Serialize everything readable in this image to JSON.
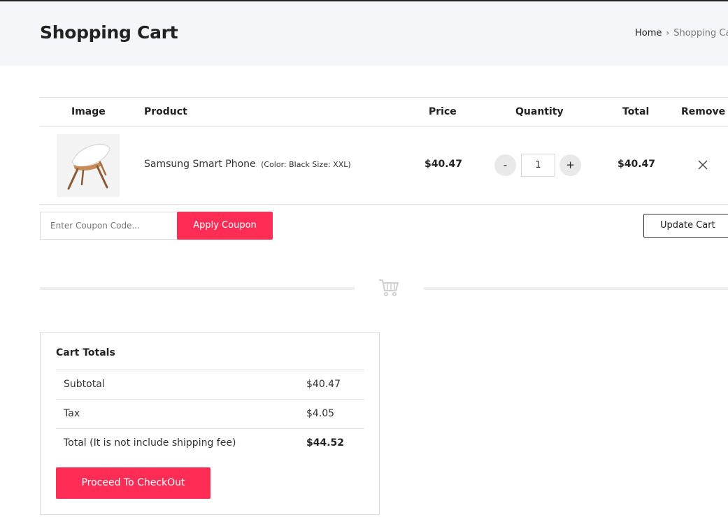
{
  "header": {
    "title": "Shopping Cart",
    "breadcrumb": {
      "home": "Home",
      "current": "Shopping Cart"
    }
  },
  "table": {
    "headers": {
      "image": "Image",
      "product": "Product",
      "price": "Price",
      "quantity": "Quantity",
      "total": "Total",
      "remove": "Remove"
    },
    "items": [
      {
        "name": "Samsung Smart Phone",
        "meta": "(Color: Black Size: XXL)",
        "price": "$40.47",
        "quantity": "1",
        "total": "$40.47",
        "image_icon": "chair-product-image"
      }
    ],
    "qty_minus": "-",
    "qty_plus": "+"
  },
  "coupon": {
    "placeholder": "Enter Coupon Code...",
    "apply_label": "Apply Coupon",
    "update_label": "Update Cart"
  },
  "divider_icon": "cart-icon",
  "totals": {
    "title": "Cart Totals",
    "rows": [
      {
        "label": "Subtotal",
        "value": "$40.47"
      },
      {
        "label": "Tax",
        "value": "$4.05"
      },
      {
        "label": "Total (It is not include shipping fee)",
        "value": "$44.52"
      }
    ],
    "checkout_label": "Proceed To CheckOut"
  },
  "colors": {
    "accent": "#ff2d55",
    "header_bg": "#f4f6f9",
    "text": "#222222"
  }
}
